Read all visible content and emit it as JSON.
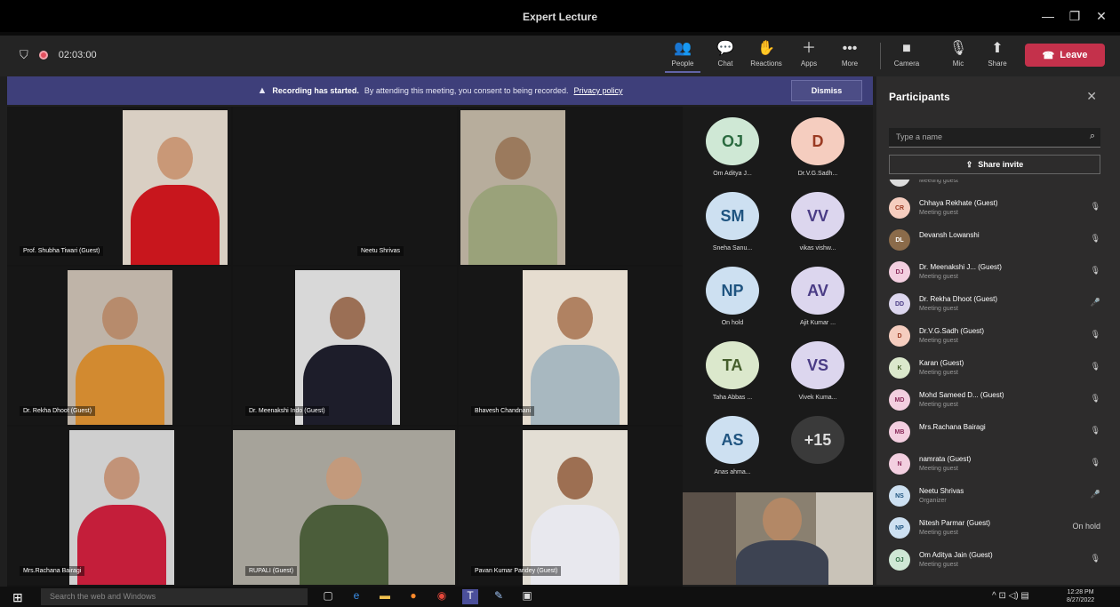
{
  "window": {
    "title": "Expert Lecture",
    "min": "—",
    "max": "❐",
    "close": "✕"
  },
  "toolbar": {
    "timer": "02:03:00",
    "buttons": [
      {
        "id": "people",
        "icon": "👥",
        "label": "People"
      },
      {
        "id": "chat",
        "icon": "💬",
        "label": "Chat"
      },
      {
        "id": "reactions",
        "icon": "✋",
        "label": "Reactions"
      },
      {
        "id": "apps",
        "icon": "＋",
        "label": "Apps"
      },
      {
        "id": "more",
        "icon": "•••",
        "label": "More"
      },
      {
        "id": "camera",
        "icon": "■",
        "label": "Camera"
      },
      {
        "id": "mic",
        "icon": "🎙",
        "label": "Mic"
      },
      {
        "id": "share",
        "icon": "⬆",
        "label": "Share"
      }
    ],
    "leave": "Leave"
  },
  "banner": {
    "bold": "Recording has started.",
    "text": "By attending this meeting, you consent to being recorded.",
    "link": "Privacy policy",
    "dismiss": "Dismiss"
  },
  "tiles": [
    {
      "name": "Prof. Shubha Tiwari (Guest)",
      "bg": "#d9cfc3",
      "shirt": "#c8161d",
      "skin": "#c99877"
    },
    {
      "name": "Neetu Shrivas",
      "bg": "#1a1a1a",
      "shirt": "#000",
      "skin": "#000"
    },
    {
      "name": "",
      "bg": "#b7ad9c",
      "shirt": "#9aa27a",
      "skin": "#9b7a5d"
    },
    {
      "name": "Dr. Rekha Dhoot (Guest)",
      "bg": "#bfb4a8",
      "shirt": "#d28a30",
      "skin": "#b78b6c"
    },
    {
      "name": "Dr. Meenakshi Indo (Guest)",
      "bg": "#d8d8d8",
      "shirt": "#1d1d2a",
      "skin": "#9b6f55"
    },
    {
      "name": "Bhavesh Chandnani",
      "bg": "#e6ddd0",
      "shirt": "#a8b8c0",
      "skin": "#b08262"
    },
    {
      "name": "Mrs.Rachana Bairagi",
      "bg": "#cfcfcf",
      "shirt": "#c41e3a",
      "skin": "#c29378"
    },
    {
      "name": "RUPALI (Guest)",
      "bg": "#a6a39a",
      "shirt": "#4b5d3a",
      "skin": "#c39a7c"
    },
    {
      "name": "Pavan Kumar Pandey (Guest)",
      "bg": "#e3ded4",
      "shirt": "#e8e8ee",
      "skin": "#9d6f52"
    }
  ],
  "avatars": [
    {
      "initials": "OJ",
      "name": "Om Aditya J...",
      "color": "#cfe8d5",
      "text": "#2b6b40"
    },
    {
      "initials": "D",
      "name": "Dr.V.G.Sadh...",
      "color": "#f5cdbf",
      "text": "#9a3a22"
    },
    {
      "initials": "SM",
      "name": "Sneha Sanu...",
      "color": "#cde0f1",
      "text": "#1f5480"
    },
    {
      "initials": "VV",
      "name": "vikas vishw...",
      "color": "#dcd6ee",
      "text": "#4a3c85"
    },
    {
      "initials": "NP",
      "name": "On hold",
      "color": "#cde0f1",
      "text": "#1f5480"
    },
    {
      "initials": "AV",
      "name": "Ajit Kumar ...",
      "color": "#dcd6ee",
      "text": "#4a3c85"
    },
    {
      "initials": "TA",
      "name": "Taha Abbas ...",
      "color": "#dbe8cc",
      "text": "#445d2b"
    },
    {
      "initials": "VS",
      "name": "Vivek Kuma...",
      "color": "#dcd6ee",
      "text": "#4a3c85"
    },
    {
      "initials": "AS",
      "name": "Anas ahma...",
      "color": "#cde0f1",
      "text": "#1f5480"
    },
    {
      "initials": "+15",
      "name": "",
      "color": "#3a3a3a",
      "text": "#ddd"
    }
  ],
  "panel": {
    "title": "Participants",
    "search_placeholder": "Type a name",
    "share_invite": "Share invite",
    "list": [
      {
        "initials": "",
        "name": "",
        "sub": "Meeting guest",
        "color": "#ddd",
        "text": "#555",
        "status": "…"
      },
      {
        "initials": "CR",
        "name": "Chhaya Rekhate (Guest)",
        "sub": "Meeting guest",
        "color": "#f5cdbf",
        "text": "#9a3a22",
        "status": "🎙"
      },
      {
        "initials": "DL",
        "name": "Devansh Lowanshi",
        "sub": "",
        "color": "#8b6b4a",
        "text": "#fff",
        "status": "🎙"
      },
      {
        "initials": "DJ",
        "name": "Dr. Meenakshi J...   (Guest)",
        "sub": "Meeting guest",
        "color": "#f3cfe0",
        "text": "#8a2a5a",
        "status": "🎙"
      },
      {
        "initials": "DD",
        "name": "Dr. Rekha Dhoot (Guest)",
        "sub": "Meeting guest",
        "color": "#dcd6ee",
        "text": "#4a3c85",
        "status": "🎤"
      },
      {
        "initials": "D",
        "name": "Dr.V.G.Sadh (Guest)",
        "sub": "Meeting guest",
        "color": "#f5cdbf",
        "text": "#9a3a22",
        "status": "🎙"
      },
      {
        "initials": "K",
        "name": "Karan (Guest)",
        "sub": "Meeting guest",
        "color": "#dbe8cc",
        "text": "#445d2b",
        "status": "🎙"
      },
      {
        "initials": "MD",
        "name": "Mohd Sameed D...  (Guest)",
        "sub": "Meeting guest",
        "color": "#f3cfe0",
        "text": "#8a2a5a",
        "status": "🎙"
      },
      {
        "initials": "MB",
        "name": "Mrs.Rachana Bairagi",
        "sub": "",
        "color": "#f3cfe0",
        "text": "#8a2a5a",
        "status": "🎙"
      },
      {
        "initials": "N",
        "name": "namrata (Guest)",
        "sub": "Meeting guest",
        "color": "#f3cfe0",
        "text": "#8a2a5a",
        "status": "🎙"
      },
      {
        "initials": "NS",
        "name": "Neetu Shrivas",
        "sub": "Organizer",
        "color": "#cde0f1",
        "text": "#1f5480",
        "status": "🎤"
      },
      {
        "initials": "NP",
        "name": "Nitesh Parmar (Guest)",
        "sub": "Meeting guest",
        "color": "#cde0f1",
        "text": "#1f5480",
        "status": "On hold"
      },
      {
        "initials": "OJ",
        "name": "Om Aditya Jain (Guest)",
        "sub": "Meeting guest",
        "color": "#cfe8d5",
        "text": "#2b6b40",
        "status": "🎙"
      }
    ]
  },
  "taskbar": {
    "search": "Search the web and Windows",
    "time": "12:28 PM",
    "date": "8/27/2022"
  }
}
